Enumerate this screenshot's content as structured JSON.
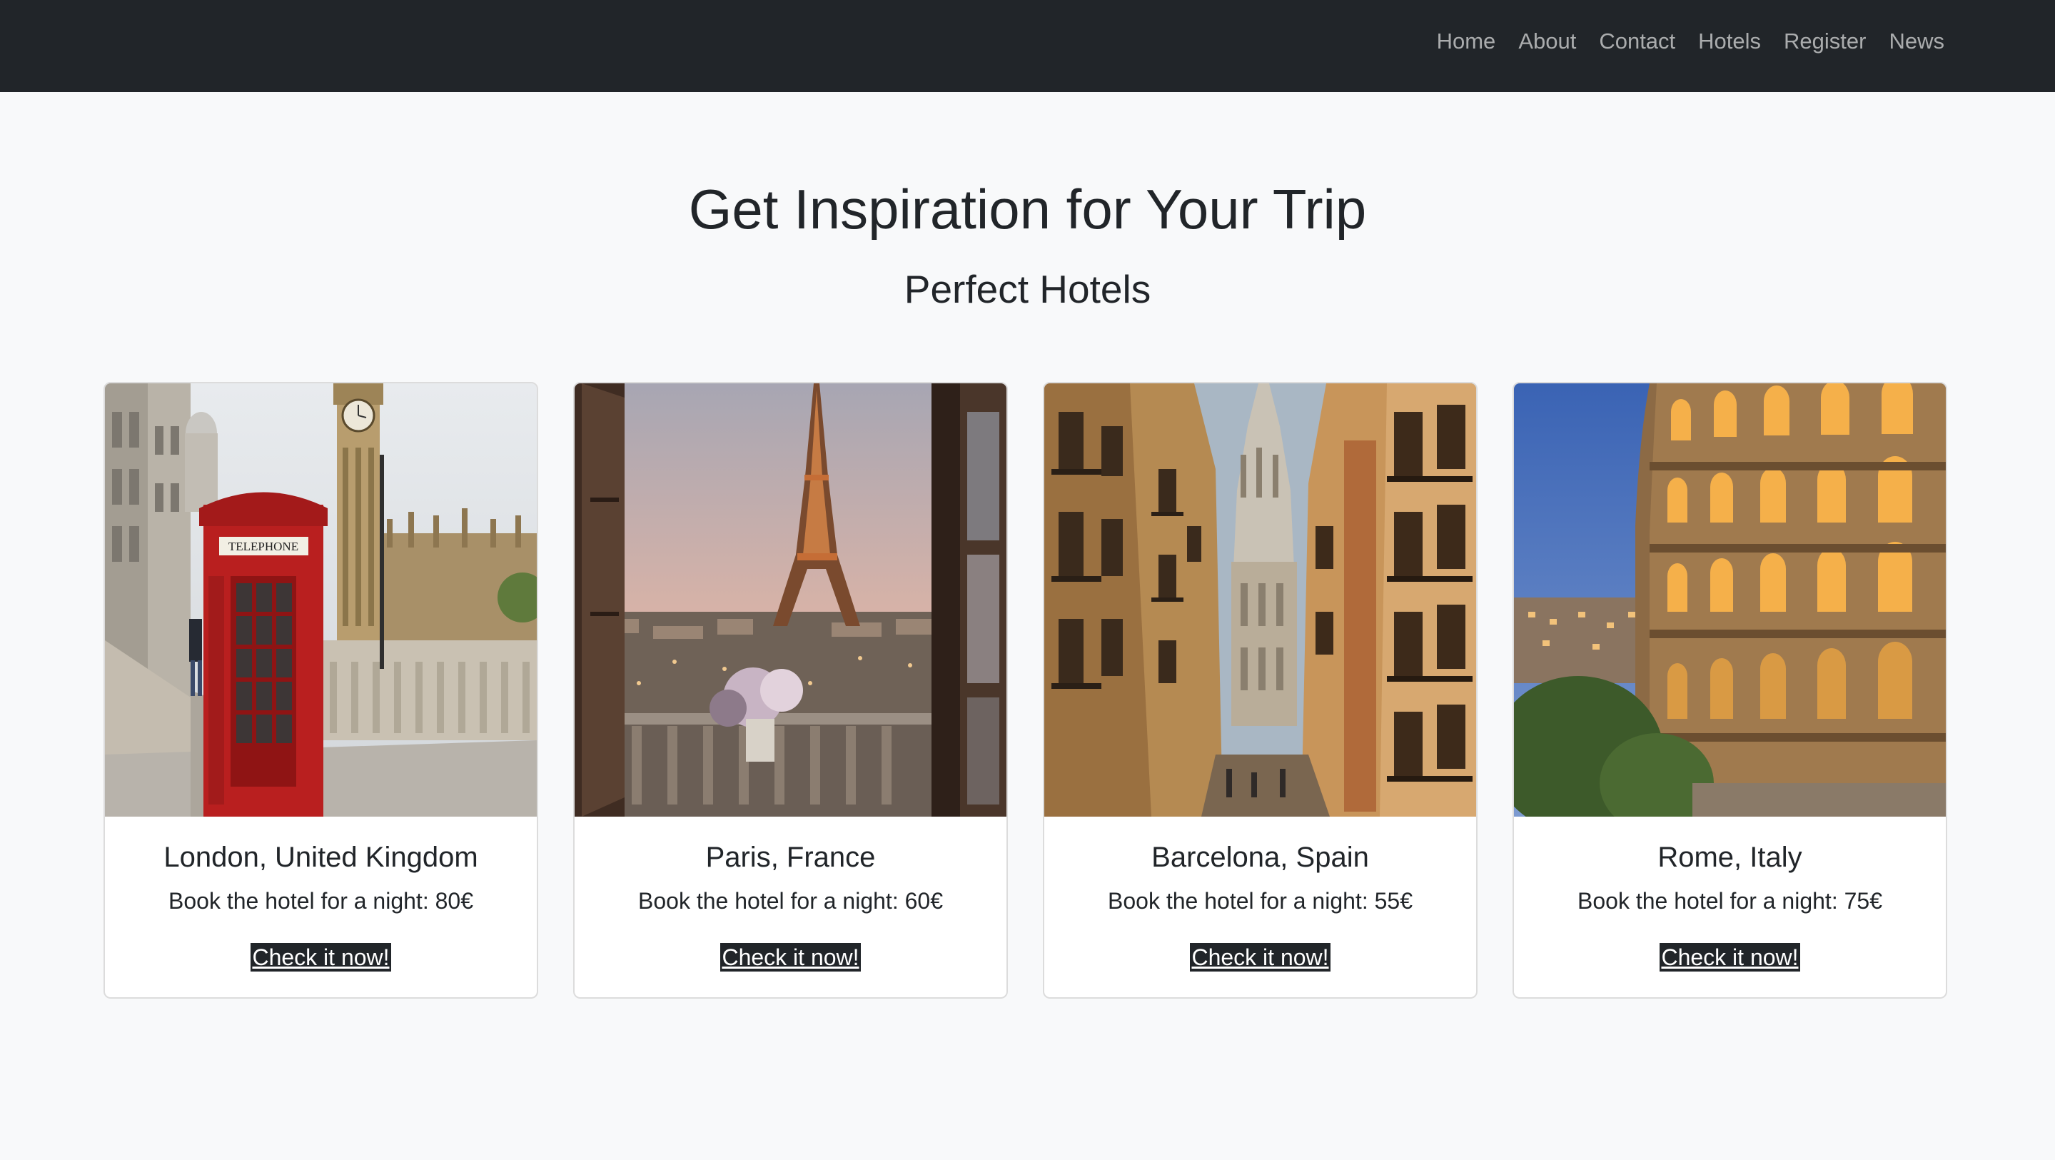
{
  "nav": {
    "items": [
      {
        "label": "Home"
      },
      {
        "label": "About"
      },
      {
        "label": "Contact"
      },
      {
        "label": "Hotels"
      },
      {
        "label": "Register"
      },
      {
        "label": "News"
      }
    ]
  },
  "hero": {
    "title": "Get Inspiration for Your Trip",
    "subtitle": "Perfect Hotels"
  },
  "cards": [
    {
      "title": "London, United Kingdom",
      "text": "Book the hotel for a night: 80€",
      "link": "Check it now!",
      "image": "london-telephone-box-big-ben"
    },
    {
      "title": "Paris, France",
      "text": "Book the hotel for a night: 60€",
      "link": "Check it now!",
      "image": "eiffel-tower-window-view"
    },
    {
      "title": "Barcelona, Spain",
      "text": "Book the hotel for a night: 55€",
      "link": "Check it now!",
      "image": "narrow-street-cathedral-tower"
    },
    {
      "title": "Rome, Italy",
      "text": "Book the hotel for a night: 75€",
      "link": "Check it now!",
      "image": "colosseum-at-dusk"
    }
  ],
  "colors": {
    "navbar_bg": "#212529",
    "page_bg": "#f8f9fa",
    "text": "#212529",
    "link_bg": "#212529",
    "link_text": "#ffffff"
  }
}
